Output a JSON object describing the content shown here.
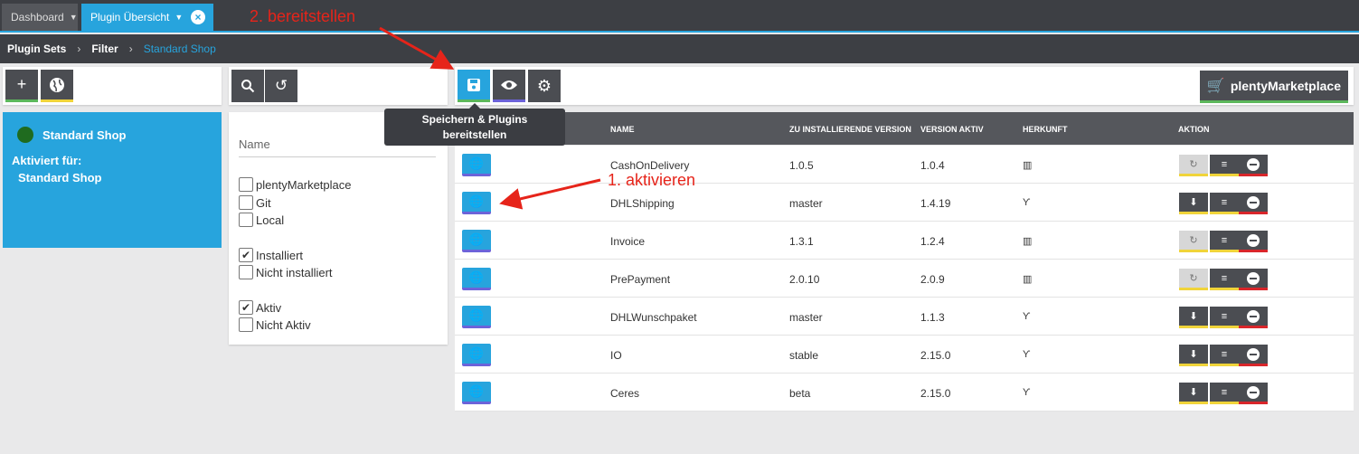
{
  "tabs": [
    {
      "label": "Dashboard"
    },
    {
      "label": "Plugin Übersicht"
    }
  ],
  "annotations": {
    "deploy": "2. bereitstellen",
    "activate": "1. aktivieren"
  },
  "breadcrumb": [
    "Plugin Sets",
    "Filter",
    "Standard Shop"
  ],
  "marketplace_button": "plentyMarketplace",
  "tooltip": {
    "line1": "Speichern & Plugins",
    "line2": "bereitstellen"
  },
  "plugin_set": {
    "name": "Standard Shop",
    "activated_label": "Aktiviert für:",
    "activated_for": "Standard Shop"
  },
  "filter": {
    "name_placeholder": "Name",
    "options": [
      {
        "label": "plentyMarketplace",
        "checked": false
      },
      {
        "label": "Git",
        "checked": false
      },
      {
        "label": "Local",
        "checked": false
      },
      {
        "label": "Installiert",
        "checked": true
      },
      {
        "label": "Nicht installiert",
        "checked": false
      },
      {
        "label": "Aktiv",
        "checked": true
      },
      {
        "label": "Nicht Aktiv",
        "checked": false
      }
    ]
  },
  "table": {
    "headers": {
      "name": "NAME",
      "to_install": "ZU INSTALLIERENDE VERSION",
      "active": "VERSION AKTIV",
      "origin": "HERKUNFT",
      "action": "AKTION"
    },
    "rows": [
      {
        "name": "CashOnDelivery",
        "to_install": "1.0.5",
        "active": "1.0.4",
        "origin": "marketplace",
        "origin_glyph": "▥",
        "first_action": "refresh"
      },
      {
        "name": "DHLShipping",
        "to_install": "master",
        "active": "1.4.19",
        "origin": "git",
        "origin_glyph": "Ƴ",
        "first_action": "download"
      },
      {
        "name": "Invoice",
        "to_install": "1.3.1",
        "active": "1.2.4",
        "origin": "marketplace",
        "origin_glyph": "▥",
        "first_action": "refresh"
      },
      {
        "name": "PrePayment",
        "to_install": "2.0.10",
        "active": "2.0.9",
        "origin": "marketplace",
        "origin_glyph": "▥",
        "first_action": "refresh"
      },
      {
        "name": "DHLWunschpaket",
        "to_install": "master",
        "active": "1.1.3",
        "origin": "git",
        "origin_glyph": "Ƴ",
        "first_action": "download"
      },
      {
        "name": "IO",
        "to_install": "stable",
        "active": "2.15.0",
        "origin": "git",
        "origin_glyph": "Ƴ",
        "first_action": "download"
      },
      {
        "name": "Ceres",
        "to_install": "beta",
        "active": "2.15.0",
        "origin": "git",
        "origin_glyph": "Ƴ",
        "first_action": "download"
      }
    ]
  },
  "colors": {
    "accent": "#27a4dd",
    "dark": "#3d3f44",
    "annotation": "#e6241a"
  }
}
